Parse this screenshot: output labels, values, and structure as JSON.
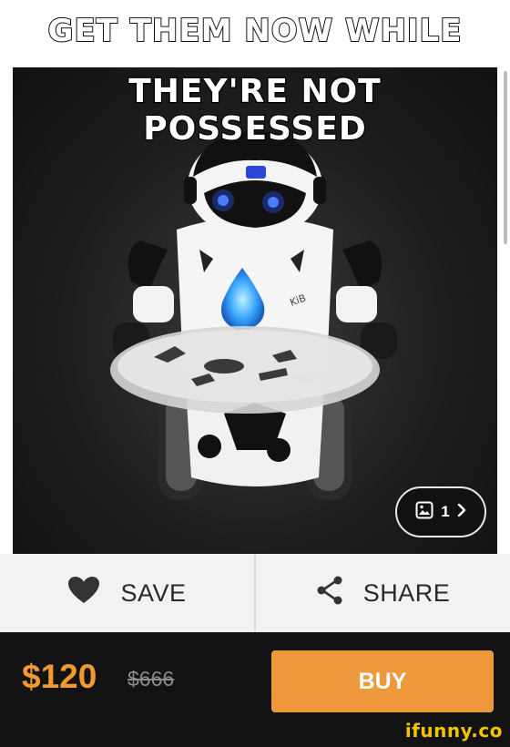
{
  "meme": {
    "caption_line1": "GET THEM NOW WHILE",
    "caption_line2": "THEY'RE NOT POSSESSED"
  },
  "gallery": {
    "icon": "image-icon",
    "count": "1",
    "chevron_icon": "chevron-right-icon"
  },
  "actions": {
    "save_label": "SAVE",
    "save_icon": "heart-icon",
    "share_label": "SHARE",
    "share_icon": "share-icon"
  },
  "product": {
    "price": "$120",
    "original_price": "$666",
    "buy_label": "BUY",
    "robot_badge_text": "KiB"
  },
  "colors": {
    "accent": "#ee9a3c",
    "price": "#f29a2e",
    "bar_bg": "#131313",
    "watermark": "#f2c400"
  },
  "watermark": {
    "text": "ifunny.co"
  }
}
